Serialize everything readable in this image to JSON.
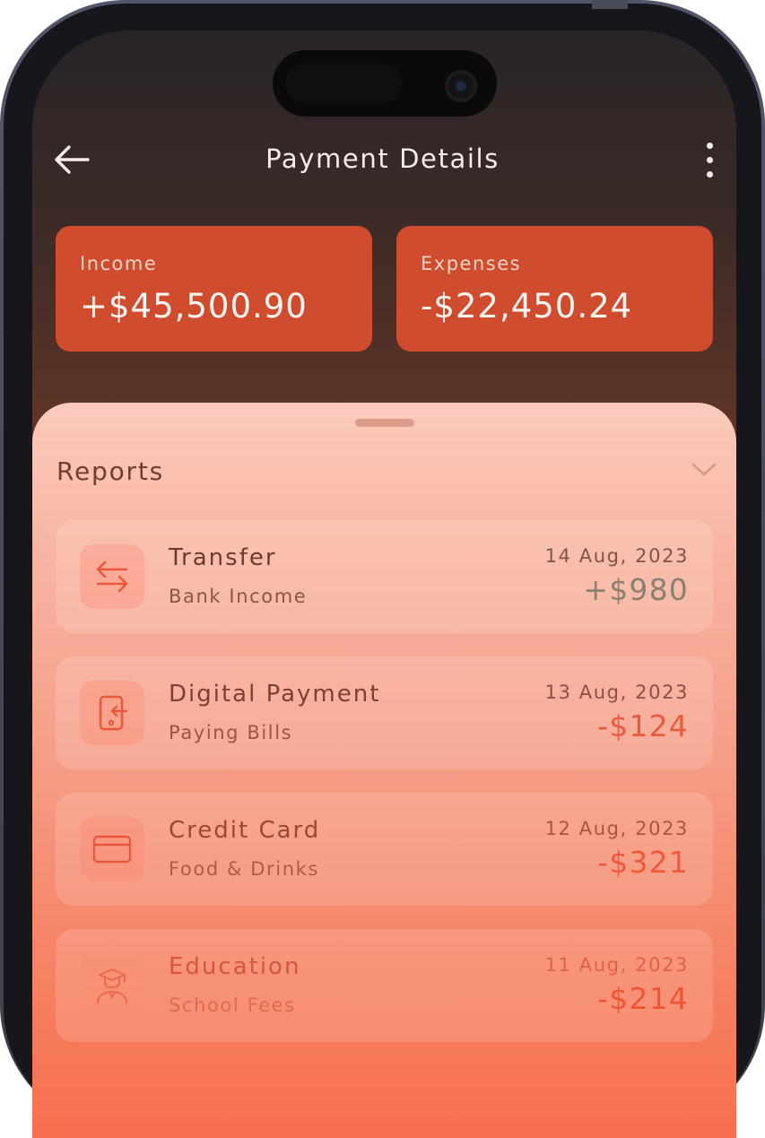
{
  "header": {
    "title": "Payment Details",
    "back_icon": "arrow-left-icon",
    "more_icon": "more-vertical-icon"
  },
  "summary": {
    "income": {
      "label": "Income",
      "amount": "+$45,500.90"
    },
    "expenses": {
      "label": "Expenses",
      "amount": "-$22,450.24"
    }
  },
  "reports": {
    "title": "Reports",
    "chevron_icon": "chevron-down-icon",
    "items": [
      {
        "name": "Transfer",
        "sub": "Bank Income",
        "date": "14 Aug, 2023",
        "amount": "+$980",
        "icon": "transfer-arrows-icon"
      },
      {
        "name": "Digital Payment",
        "sub": "Paying Bills",
        "date": "13 Aug, 2023",
        "amount": "-$124",
        "icon": "mobile-payment-icon"
      },
      {
        "name": "Credit Card",
        "sub": "Food & Drinks",
        "date": "12 Aug, 2023",
        "amount": "-$321",
        "icon": "credit-card-icon"
      },
      {
        "name": "Education",
        "sub": "School Fees",
        "date": "11 Aug, 2023",
        "amount": "-$214",
        "icon": "graduate-icon"
      }
    ]
  },
  "colors": {
    "accent": "#cf4c2f",
    "income_amount": "#8a8173",
    "expense_amount": "#e75c3e"
  }
}
